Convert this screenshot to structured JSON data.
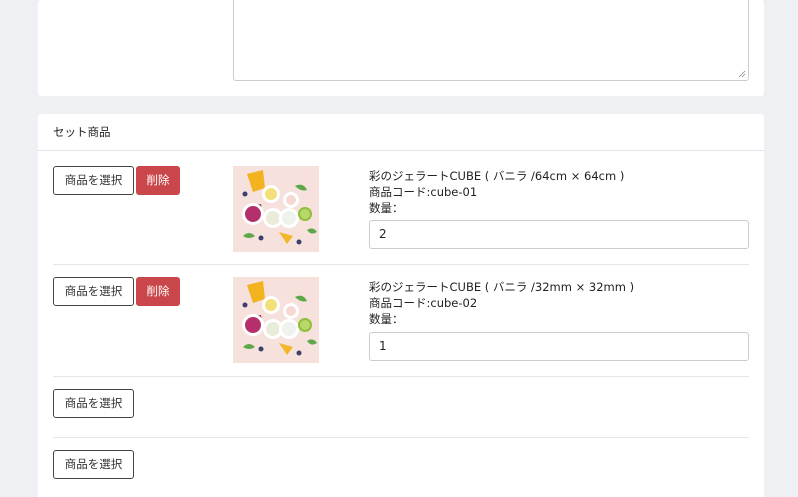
{
  "set_section": {
    "title": "セット商品",
    "select_label": "商品を選択",
    "delete_label": "削除",
    "items": [
      {
        "name": "彩のジェラートCUBE ( バニラ /64cm × 64cm )",
        "code": "商品コード:cube-01",
        "qty_label": "数量：",
        "qty_value": "2"
      },
      {
        "name": "彩のジェラートCUBE ( バニラ /32mm × 32mm )",
        "code": "商品コード:cube-02",
        "qty_label": "数量：",
        "qty_value": "1"
      }
    ],
    "empty_slots": 2
  },
  "colors": {
    "page_bg": "#eef0f4",
    "delete_bg": "#c9474a",
    "border": "#c9ccd1"
  }
}
